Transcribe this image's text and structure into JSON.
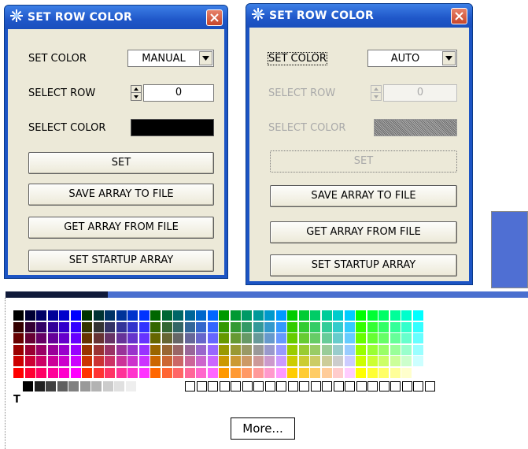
{
  "dialog_manual": {
    "title": "SET ROW COLOR",
    "set_color_label": "SET COLOR",
    "set_color_value": "MANUAL",
    "select_row_label": "SELECT ROW",
    "select_row_value": "0",
    "select_color_label": "SELECT COLOR",
    "swatch_color": "#000000",
    "buttons": [
      "SET",
      "SAVE ARRAY TO FILE",
      "GET ARRAY FROM FILE",
      "SET STARTUP ARRAY"
    ]
  },
  "dialog_auto": {
    "title": "SET ROW COLOR",
    "set_color_label": "SET COLOR",
    "set_color_value": "AUTO",
    "select_row_label": "SELECT ROW",
    "select_row_value": "0",
    "select_color_label": "SELECT COLOR",
    "buttons": [
      "SET",
      "SAVE ARRAY TO FILE",
      "GET ARRAY FROM FILE",
      "SET STARTUP ARRAY"
    ]
  },
  "color_preview": "#4f6fd3",
  "palette": {
    "transparent_label": "T",
    "more_label": "More...",
    "grays": [
      "#000000",
      "#202020",
      "#404040",
      "#606060",
      "#808080",
      "#999999",
      "#b3b3b3",
      "#cccccc",
      "#e0e0e0",
      "#eeeeee"
    ],
    "custom_empty_count": 22
  }
}
